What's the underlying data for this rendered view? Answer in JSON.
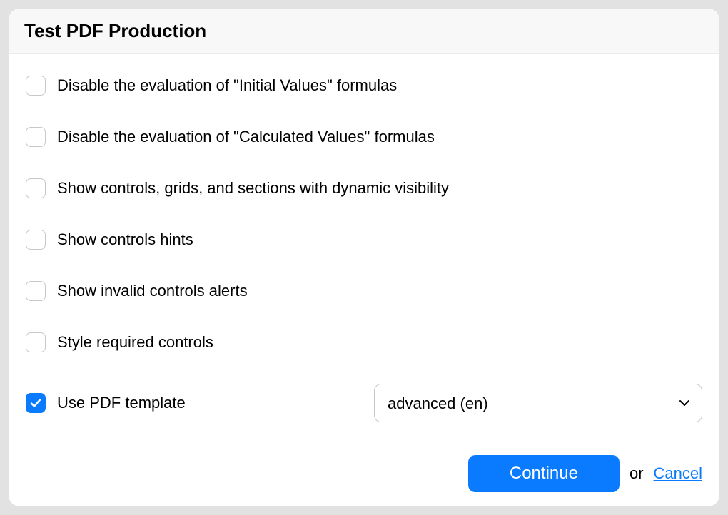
{
  "dialog": {
    "title": "Test PDF Production"
  },
  "options": {
    "disable_initial": {
      "label": "Disable the evaluation of \"Initial Values\" formulas",
      "checked": false
    },
    "disable_calculated": {
      "label": "Disable the evaluation of \"Calculated Values\" formulas",
      "checked": false
    },
    "show_dynamic": {
      "label": "Show controls, grids, and sections with dynamic visibility",
      "checked": false
    },
    "show_hints": {
      "label": "Show controls hints",
      "checked": false
    },
    "show_invalid": {
      "label": "Show invalid controls alerts",
      "checked": false
    },
    "style_required": {
      "label": "Style required controls",
      "checked": false
    },
    "use_template": {
      "label": "Use PDF template",
      "checked": true
    }
  },
  "template_select": {
    "value": "advanced (en)"
  },
  "actions": {
    "continue_label": "Continue",
    "or_text": "or",
    "cancel_label": "Cancel"
  }
}
